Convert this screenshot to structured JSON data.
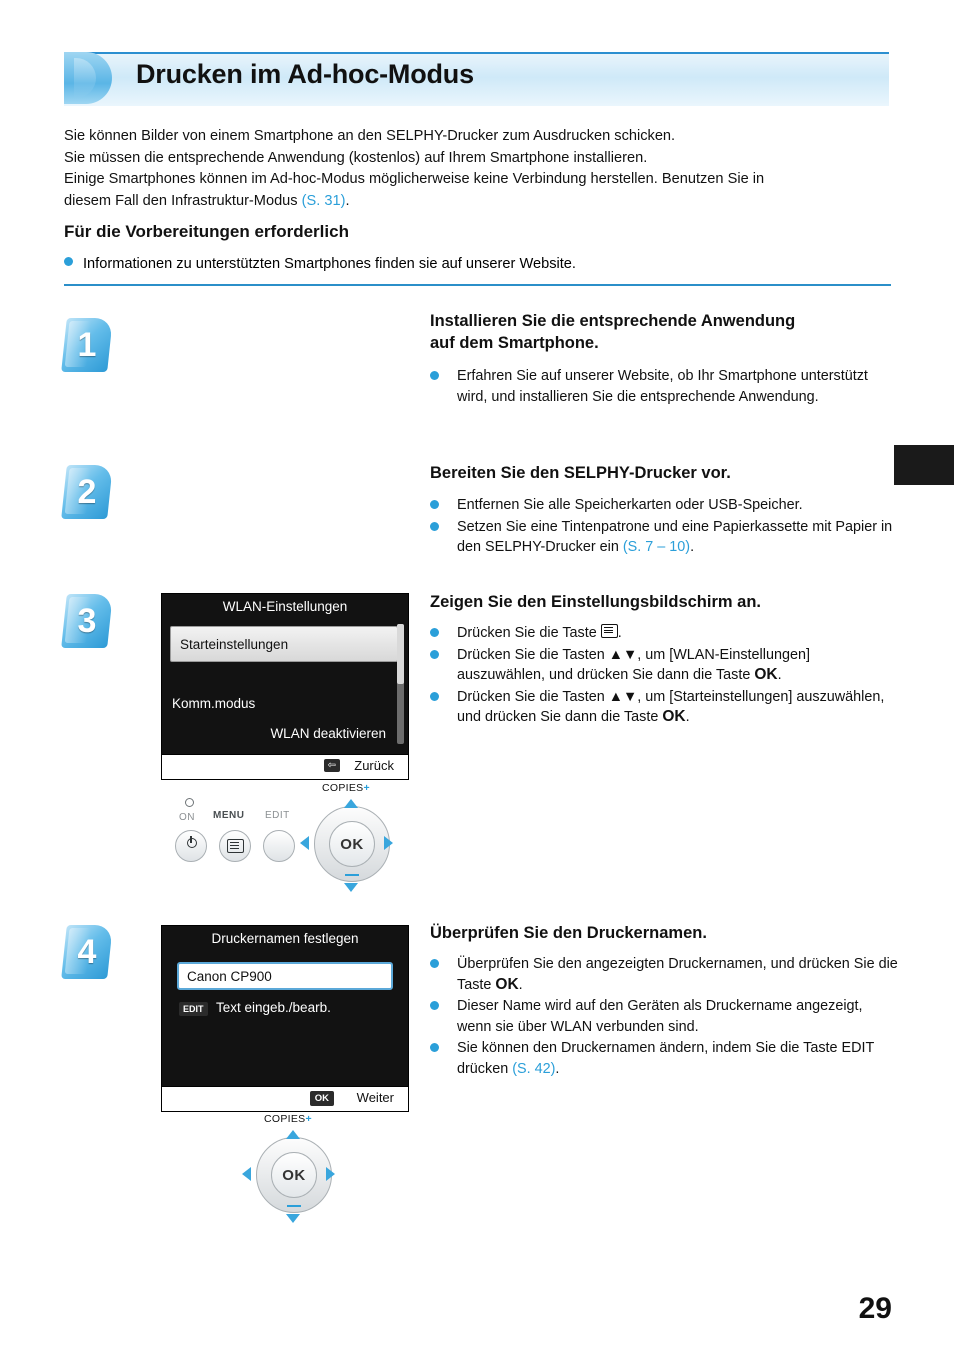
{
  "header": {
    "title": "Drucken im Ad-hoc-Modus"
  },
  "intro": {
    "line1": "Sie können Bilder von einem Smartphone an den SELPHY-Drucker zum Ausdrucken schicken.",
    "line2": "Sie müssen die entsprechende Anwendung (kostenlos) auf Ihrem Smartphone installieren.",
    "line3": "Einige Smartphones können im Ad-hoc-Modus möglicherweise keine Verbindung herstellen. Benutzen Sie in",
    "line4_pre": "diesem Fall den Infrastruktur-Modus ",
    "line4_link": "(S. 31)",
    "line4_post": "."
  },
  "prep": {
    "heading": "Für die Vorbereitungen erforderlich",
    "bullet": "Informationen zu unterstützten Smartphones finden sie auf unserer Website."
  },
  "steps": [
    {
      "number": "1",
      "title_line1": "Installieren Sie die entsprechende Anwendung",
      "title_line2": "auf dem Smartphone.",
      "items": [
        "Erfahren Sie auf unserer Website, ob Ihr Smartphone unterstützt wird, und installieren Sie die entsprechende Anwendung."
      ]
    },
    {
      "number": "2",
      "title_line1": "Bereiten Sie den SELPHY-Drucker vor.",
      "items": [
        "Entfernen Sie alle Speicherkarten oder USB-Speicher.",
        "Setzen Sie eine Tintenpatrone und eine Papierkassette mit Papier in den SELPHY-Drucker ein"
      ],
      "item2_link": "(S. 7 – 10)"
    },
    {
      "number": "3",
      "title_line1": "Zeigen Sie den Einstellungsbildschirm an.",
      "items": [
        "Drücken Sie die Taste",
        "Drücken Sie die Tasten ▲▼, um [WLAN-Einstellungen] auszuwählen, und drücken Sie dann die Taste",
        "Drücken Sie die Tasten ▲▼, um [Starteinstellungen] auszuwählen, und drücken Sie dann die Taste"
      ],
      "ok_label": "OK"
    },
    {
      "number": "4",
      "title_line1": "Überprüfen Sie den Druckernamen.",
      "items": [
        "Überprüfen Sie den angezeigten Druckernamen, und drücken Sie die Taste",
        "Dieser Name wird auf den Geräten als Druckername angezeigt, wenn sie über WLAN verbunden sind.",
        "Sie können den Druckernamen ändern, indem Sie die Taste EDIT drücken"
      ],
      "ok_label": "OK",
      "item3_link": "(S. 42)"
    }
  ],
  "lcd_wlan": {
    "title": "WLAN-Einstellungen",
    "item_selected": "Starteinstellungen",
    "label_comm": "Komm.modus",
    "value_comm": "WLAN deaktivieren",
    "footer_label": "Zurück",
    "footer_badge": "⇦"
  },
  "lcd_name": {
    "title": "Druckernamen festlegen",
    "field_value": "Canon CP900",
    "edit_badge": "EDIT",
    "edit_label": "Text eingeb./bearb.",
    "footer_badge": "OK",
    "footer_label": "Weiter"
  },
  "cluster1": {
    "on_label": "ON",
    "menu_label": "MENU",
    "edit_label": "EDIT",
    "copies_label": "COPIES",
    "ok_label": "OK"
  },
  "cluster2": {
    "copies_label": "COPIES",
    "ok_label": "OK"
  },
  "page_number": "29"
}
